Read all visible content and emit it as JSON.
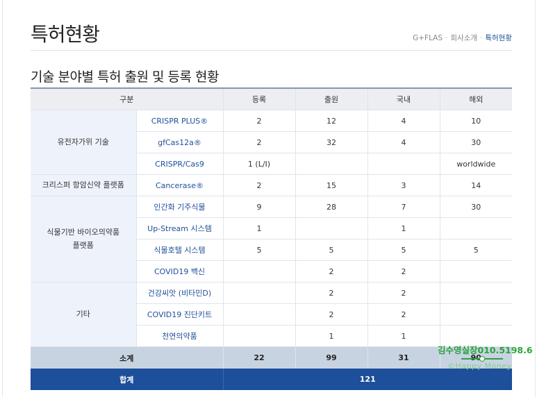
{
  "page": {
    "title": "특허현황"
  },
  "breadcrumb": {
    "items": [
      "G+FLAS",
      "회사소개",
      "특허현황"
    ],
    "separator": "·"
  },
  "section": {
    "title": "기술 분야별 특허 출원 및 등록 현황"
  },
  "table": {
    "headers": {
      "category": "구분",
      "registered": "등록",
      "applied": "출원",
      "domestic": "국내",
      "overseas": "해외"
    },
    "groups": [
      {
        "name": "유전자가위 기술",
        "rows": [
          {
            "tech": "CRISPR PLUS®",
            "registered": "2",
            "applied": "12",
            "domestic": "4",
            "overseas": "10"
          },
          {
            "tech": "gfCas12a®",
            "registered": "2",
            "applied": "32",
            "domestic": "4",
            "overseas": "30"
          },
          {
            "tech": "CRISPR/Cas9",
            "registered": "1 (L/I)",
            "applied": "",
            "domestic": "",
            "overseas": "worldwide"
          }
        ]
      },
      {
        "name": "크리스퍼 항암신약 플랫폼",
        "rows": [
          {
            "tech": "Cancerase®",
            "registered": "2",
            "applied": "15",
            "domestic": "3",
            "overseas": "14"
          }
        ]
      },
      {
        "name_line1": "식물기반 바이오의약품",
        "name_line2": "플랫폼",
        "rows": [
          {
            "tech": "인간화 기주식물",
            "registered": "9",
            "applied": "28",
            "domestic": "7",
            "overseas": "30"
          },
          {
            "tech": "Up-Stream 시스템",
            "registered": "1",
            "applied": "",
            "domestic": "1",
            "overseas": ""
          },
          {
            "tech": "식물호텔 시스템",
            "registered": "5",
            "applied": "5",
            "domestic": "5",
            "overseas": "5"
          },
          {
            "tech": "COVID19 백신",
            "registered": "",
            "applied": "2",
            "domestic": "2",
            "overseas": ""
          }
        ]
      },
      {
        "name": "기타",
        "rows": [
          {
            "tech": "건강씨앗 (비타민D)",
            "registered": "",
            "applied": "2",
            "domestic": "2",
            "overseas": ""
          },
          {
            "tech": "COVID19 진단키트",
            "registered": "",
            "applied": "2",
            "domestic": "2",
            "overseas": ""
          },
          {
            "tech": "천연의약품",
            "registered": "",
            "applied": "1",
            "domestic": "1",
            "overseas": ""
          }
        ]
      }
    ],
    "subtotal": {
      "label": "소계",
      "registered": "22",
      "applied": "99",
      "domestic": "31",
      "overseas": "90"
    },
    "total": {
      "label": "합계",
      "value": "121"
    }
  },
  "watermark": {
    "name": "김수영실장010.5198.6",
    "sub": "©Happy Money"
  },
  "colors": {
    "accent": "#1d4f9a",
    "group_bg": "#eef3fb",
    "subtotal_bg": "#c8d3e2",
    "watermark": "#2aa43a"
  }
}
